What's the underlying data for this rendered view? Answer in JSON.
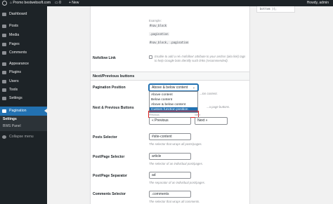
{
  "admin_bar": {
    "site_name": "Promo bestwebsoft.com",
    "comments_count": "0",
    "new_label": "+ New",
    "howdy": "Howdy, admin"
  },
  "sidebar": {
    "items": [
      {
        "label": "Dashboard",
        "icon": "dashboard-icon"
      },
      {
        "label": "Posts",
        "icon": "pin-icon"
      },
      {
        "label": "Media",
        "icon": "media-icon"
      },
      {
        "label": "Pages",
        "icon": "page-icon"
      },
      {
        "label": "Comments",
        "icon": "comment-icon"
      },
      {
        "label": "Appearance",
        "icon": "brush-icon"
      },
      {
        "label": "Plugins",
        "icon": "plugin-icon"
      },
      {
        "label": "Users",
        "icon": "user-icon"
      },
      {
        "label": "Tools",
        "icon": "wrench-icon"
      },
      {
        "label": "Settings",
        "icon": "settings-icon"
      },
      {
        "label": "Pagination",
        "icon": "pagination-icon"
      }
    ],
    "submenu": [
      "Settings",
      "BWS Panel"
    ],
    "collapse_label": "Collapse menu"
  },
  "content": {
    "example_label": "Example:",
    "example_codes": [
      "#nav_block",
      ".pagination",
      "#nav_block, .pagination"
    ],
    "nofollow": {
      "label": "Nofollow Link",
      "help_line1": "Enable to add a rel='nofollow' attribute to your anchor (aka link) tags to help Google bots identify such links (recommended)."
    },
    "section_title": "Next/Previous buttons",
    "pagination_position": {
      "label": "Pagination Position",
      "selected": "Above & below content",
      "options": [
        "Above content",
        "Below content",
        "Above & below content",
        "Custom function position"
      ],
      "help": "...ion content."
    },
    "next_prev": {
      "label": "Next & Previous Buttons",
      "help": "...a page buttons.",
      "previous_caption": "Previous",
      "next_caption": "Next",
      "previous_value": "« Previous",
      "next_value": "Next »"
    },
    "posts_selector": {
      "label": "Posts Selector",
      "value": "#site-content",
      "help": "The selector that wraps all posts/pages."
    },
    "post_page_selector": {
      "label": "Post/Page Selector",
      "value": "article",
      "help": "The selector of an individual post/pages."
    },
    "post_page_separator": {
      "label": "Post/Page Separator",
      "value": "ad",
      "help": "The separator of an individual post/pages."
    },
    "comments_selector": {
      "label": "Comments Selector",
      "value": ".comments",
      "help": "The selector that wraps all comments."
    }
  },
  "right_box": {
    "code": "bottom ));"
  }
}
